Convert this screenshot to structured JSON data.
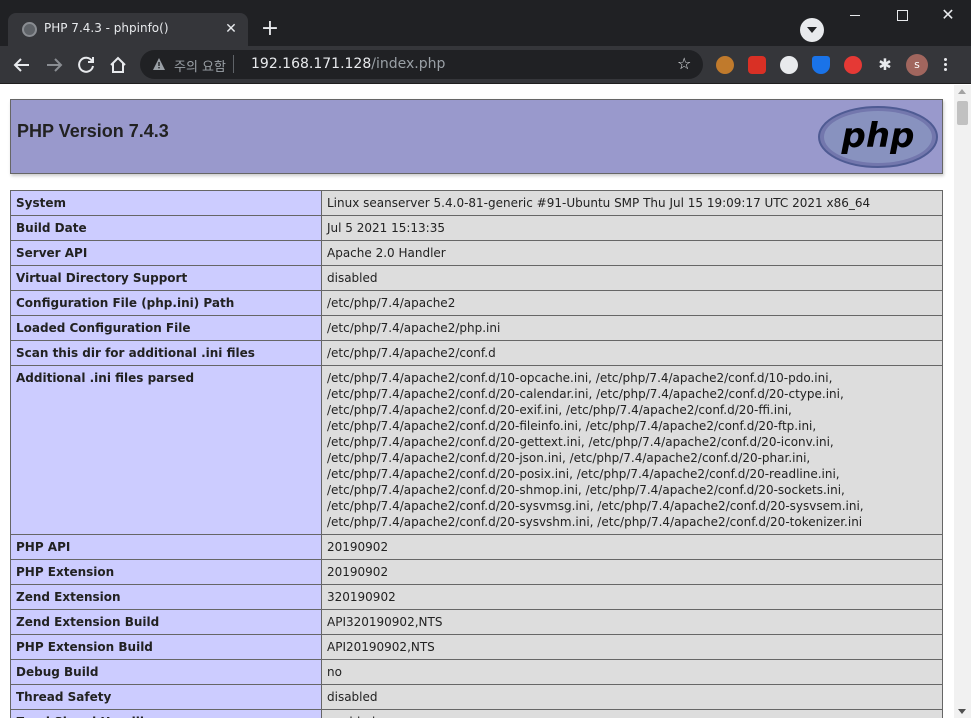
{
  "browser": {
    "tab_title": "PHP 7.4.3 - phpinfo()",
    "security_label": "주의 요함",
    "url_host": "192.168.171.128",
    "url_path": "/index.php",
    "profile_initial": "s"
  },
  "page": {
    "heading": "PHP Version 7.4.3",
    "logo_text": "php",
    "rows": [
      {
        "key": "System",
        "value": "Linux seanserver 5.4.0-81-generic #91-Ubuntu SMP Thu Jul 15 19:09:17 UTC 2021 x86_64"
      },
      {
        "key": "Build Date",
        "value": "Jul 5 2021 15:13:35"
      },
      {
        "key": "Server API",
        "value": "Apache 2.0 Handler"
      },
      {
        "key": "Virtual Directory Support",
        "value": "disabled"
      },
      {
        "key": "Configuration File (php.ini) Path",
        "value": "/etc/php/7.4/apache2"
      },
      {
        "key": "Loaded Configuration File",
        "value": "/etc/php/7.4/apache2/php.ini"
      },
      {
        "key": "Scan this dir for additional .ini files",
        "value": "/etc/php/7.4/apache2/conf.d"
      },
      {
        "key": "Additional .ini files parsed",
        "value": "/etc/php/7.4/apache2/conf.d/10-opcache.ini, /etc/php/7.4/apache2/conf.d/10-pdo.ini, /etc/php/7.4/apache2/conf.d/20-calendar.ini, /etc/php/7.4/apache2/conf.d/20-ctype.ini, /etc/php/7.4/apache2/conf.d/20-exif.ini, /etc/php/7.4/apache2/conf.d/20-ffi.ini, /etc/php/7.4/apache2/conf.d/20-fileinfo.ini, /etc/php/7.4/apache2/conf.d/20-ftp.ini, /etc/php/7.4/apache2/conf.d/20-gettext.ini, /etc/php/7.4/apache2/conf.d/20-iconv.ini, /etc/php/7.4/apache2/conf.d/20-json.ini, /etc/php/7.4/apache2/conf.d/20-phar.ini, /etc/php/7.4/apache2/conf.d/20-posix.ini, /etc/php/7.4/apache2/conf.d/20-readline.ini, /etc/php/7.4/apache2/conf.d/20-shmop.ini, /etc/php/7.4/apache2/conf.d/20-sockets.ini, /etc/php/7.4/apache2/conf.d/20-sysvmsg.ini, /etc/php/7.4/apache2/conf.d/20-sysvsem.ini, /etc/php/7.4/apache2/conf.d/20-sysvshm.ini, /etc/php/7.4/apache2/conf.d/20-tokenizer.ini"
      },
      {
        "key": "PHP API",
        "value": "20190902"
      },
      {
        "key": "PHP Extension",
        "value": "20190902"
      },
      {
        "key": "Zend Extension",
        "value": "320190902"
      },
      {
        "key": "Zend Extension Build",
        "value": "API320190902,NTS"
      },
      {
        "key": "PHP Extension Build",
        "value": "API20190902,NTS"
      },
      {
        "key": "Debug Build",
        "value": "no"
      },
      {
        "key": "Thread Safety",
        "value": "disabled"
      },
      {
        "key": "Zend Signal Handling",
        "value": "enabled"
      }
    ]
  },
  "colors": {
    "header_bg": "#9999cc",
    "key_cell_bg": "#ccccff",
    "value_cell_bg": "#dddddd",
    "chrome_dark": "#202124",
    "chrome_toolbar": "#35363a"
  }
}
